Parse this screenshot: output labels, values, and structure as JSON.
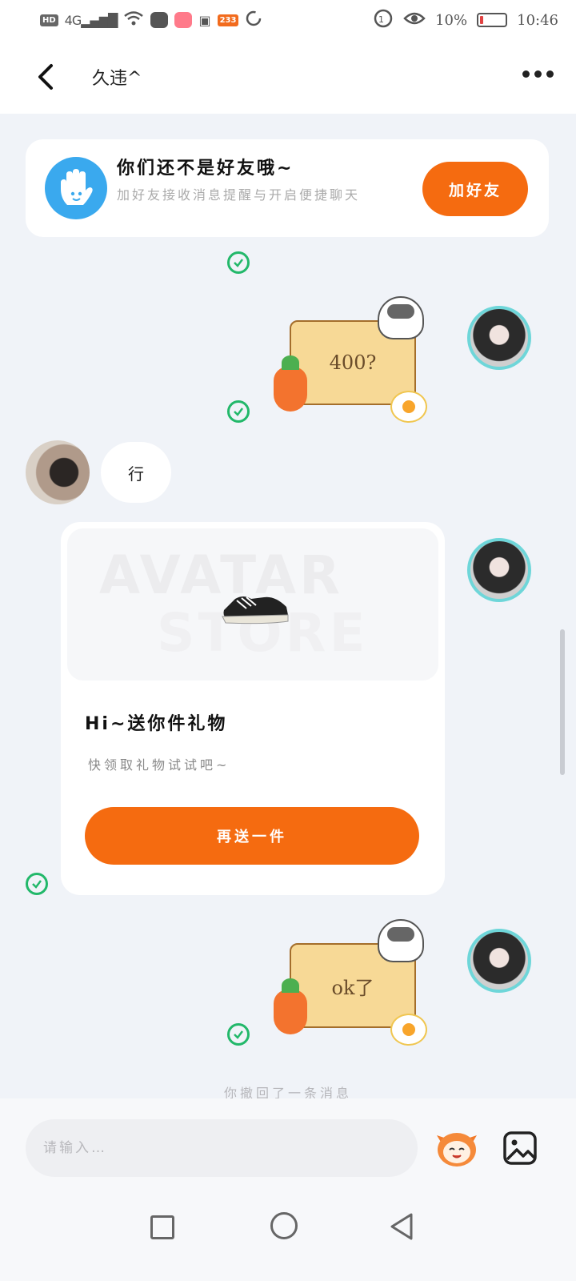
{
  "statusbar": {
    "net_badge": "HD",
    "signal": "4G",
    "app_badge": "233",
    "battery_pct": "10%",
    "time": "10:46"
  },
  "header": {
    "title": "久违^"
  },
  "friend_card": {
    "title": "你们还不是好友哦~",
    "subtitle": "加好友接收消息提醒与开启便捷聊天",
    "add_label": "加好友"
  },
  "messages": {
    "sticker1_text": "400?",
    "left_text": "行",
    "gift": {
      "watermark_line1": "AVATAR",
      "watermark_line2": "STORE",
      "title": "Hi~送你件礼物",
      "subtitle": "快领取礼物试试吧~",
      "button": "再送一件"
    },
    "sticker2_text": "ok了",
    "recall_notice": "你撤回了一条消息"
  },
  "input": {
    "placeholder": "请输入…"
  },
  "colors": {
    "accent": "#f56b10",
    "check": "#22b86a",
    "hand_blue": "#3aa9ee"
  },
  "icons": [
    "back-icon",
    "more-icon",
    "hand-icon",
    "check-icon",
    "emoji-icon",
    "image-icon",
    "nav-square-icon",
    "nav-home-icon",
    "nav-back-icon"
  ]
}
